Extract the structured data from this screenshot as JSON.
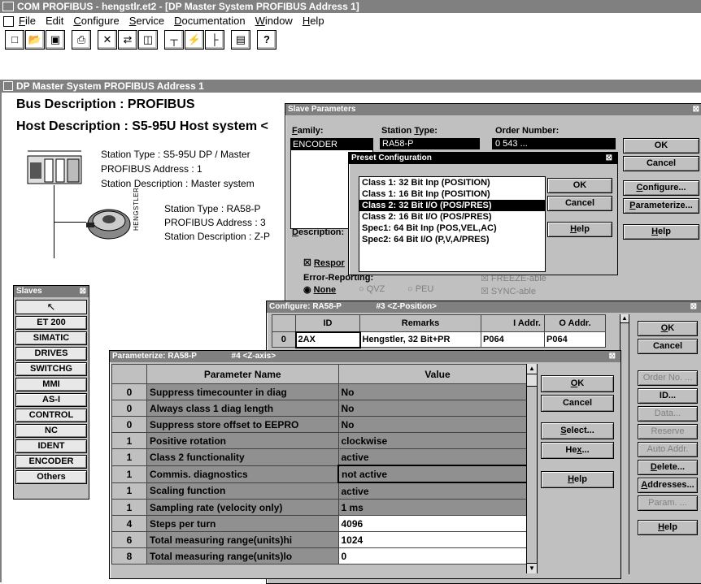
{
  "app_title": "COM PROFIBUS - hengstlr.et2 - [DP Master System PROFIBUS Address  1]",
  "menu": [
    "File",
    "Edit",
    "Configure",
    "Service",
    "Documentation",
    "Window",
    "Help"
  ],
  "toolbar_icons": [
    "new-icon",
    "open-icon",
    "save-icon",
    "print-icon",
    "cut-icon",
    "copy-icon",
    "paste-icon",
    "network-icon",
    "lightning-icon",
    "tree-icon",
    "station-icon",
    "help-icon"
  ],
  "child_title": "DP Master System PROFIBUS Address  1",
  "bus_description": "Bus Description : PROFIBUS",
  "host_description": "Host Description : S5-95U  Host system <",
  "master": {
    "station_type": "Station Type : S5-95U DP / Master",
    "address": "PROFIBUS Address : 1",
    "description": "Station Description : Master system"
  },
  "encoder": {
    "vertical_label": "HENGSTLER",
    "station_type": "Station Type : RA58-P",
    "address": "PROFIBUS Address : 3",
    "description": "Station Description : Z-P"
  },
  "slaves_panel": {
    "title": "Slaves",
    "items": [
      "ET 200",
      "SIMATIC",
      "DRIVES",
      "SWITCHG",
      "MMI",
      "AS-I",
      "CONTROL",
      "NC",
      "IDENT",
      "ENCODER",
      "Others"
    ]
  },
  "slave_params": {
    "title": "Slave Parameters",
    "family_label": "Family:",
    "station_type_label": "Station Type:",
    "order_number_label": "Order Number:",
    "family_value": "ENCODER",
    "station_type_value": "RA58-P",
    "order_number_value": "0 543 ...",
    "description_label": "Description:",
    "response_label": "Respor",
    "error_reporting_label": "Error-Reporting:",
    "none_label": "None",
    "qvz_label": "QVZ",
    "peu_label": "PEU",
    "freeze_label": "FREEZE-able",
    "sync_label": "SYNC-able",
    "buttons": [
      "OK",
      "Cancel",
      "Configure...",
      "Parameterize...",
      "Help"
    ]
  },
  "preset": {
    "title": "Preset Configuration",
    "items": [
      "Class 1: 32 Bit Inp (POSITION)",
      "Class 1: 16 Bit Inp (POSITION)",
      "Class 2: 32 Bit I/O (POS/PRES)",
      "Class 2: 16 Bit I/O (POS/PRES)",
      "Spec1: 64 Bit Inp (POS,VEL,AC)",
      "Spec2: 64 Bit I/O (P,V,A/PRES)"
    ],
    "selected_index": 2,
    "buttons": [
      "OK",
      "Cancel",
      "Help"
    ]
  },
  "configure": {
    "title": "Configure: RA58-P",
    "slot": "#3  <Z-Position>",
    "headers": [
      "ID",
      "Remarks",
      "I Addr.",
      "O Addr."
    ],
    "row": {
      "index": "0",
      "id": "2AX",
      "remarks": "Hengstler, 32 Bit+PR",
      "i_addr": "P064",
      "o_addr": "P064"
    },
    "buttons": [
      "OK",
      "Cancel",
      "Order No. ...",
      "ID...",
      "Data...",
      "Reserve",
      "Auto Addr.",
      "Delete...",
      "Addresses...",
      "Param. ...",
      "Help"
    ]
  },
  "parameterize": {
    "title": "Parameterize: RA58-P",
    "slot": "#4  <Z-axis>",
    "headers": [
      "Parameter Name",
      "Value"
    ],
    "rows": [
      {
        "idx": "0",
        "name": "Suppress timecounter in diag",
        "value": "No"
      },
      {
        "idx": "0",
        "name": "Always class 1 diag length",
        "value": "No"
      },
      {
        "idx": "0",
        "name": "Suppress store offset to EEPRO",
        "value": "No"
      },
      {
        "idx": "1",
        "name": "Positive rotation",
        "value": "clockwise"
      },
      {
        "idx": "1",
        "name": "Class 2 functionality",
        "value": "active"
      },
      {
        "idx": "1",
        "name": "Commis. diagnostics",
        "value": "not active"
      },
      {
        "idx": "1",
        "name": "Scaling function",
        "value": "active"
      },
      {
        "idx": "1",
        "name": "Sampling rate (velocity only)",
        "value": "1 ms"
      },
      {
        "idx": "4",
        "name": "Steps per turn",
        "value": "4096"
      },
      {
        "idx": "6",
        "name": "Total measuring range(units)hi",
        "value": "1024"
      },
      {
        "idx": "8",
        "name": "Total measuring range(units)lo",
        "value": "0"
      }
    ],
    "buttons": [
      "OK",
      "Cancel",
      "Select...",
      "Hex...",
      "Help"
    ]
  }
}
